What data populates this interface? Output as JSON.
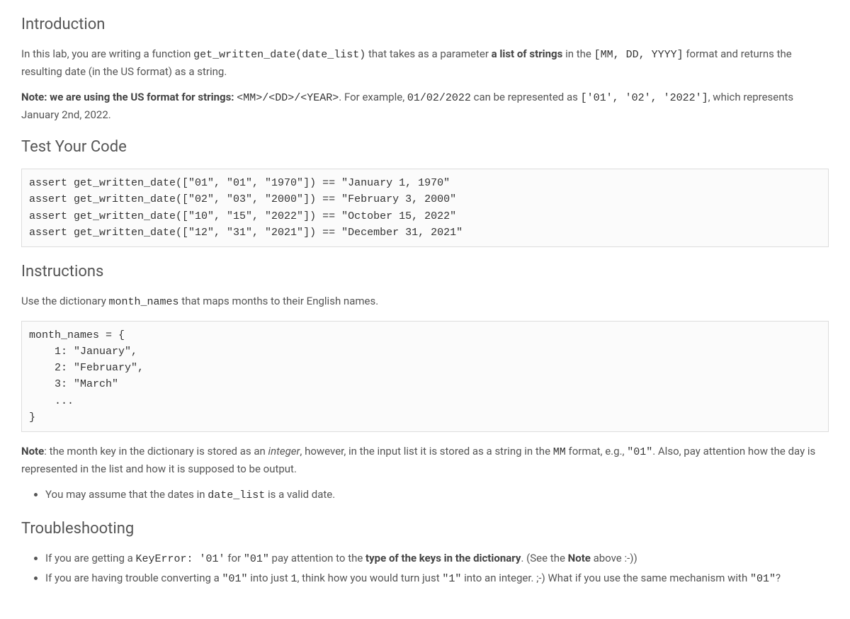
{
  "intro": {
    "heading": "Introduction",
    "p1_a": "In this lab, you are writing a function ",
    "p1_code1": "get_written_date(date_list)",
    "p1_b": " that takes as a parameter ",
    "p1_bold": "a list of strings",
    "p1_c": " in the ",
    "p1_code2": "[MM, DD, YYYY]",
    "p1_d": " format and returns the resulting date (in the US format) as a string.",
    "p2_bold": "Note: we are using the US format for strings: ",
    "p2_code1": "<MM>/<DD>/<YEAR>",
    "p2_a": ". For example, ",
    "p2_code2": "01/02/2022",
    "p2_b": " can be represented as ",
    "p2_code3": "['01', '02', '2022']",
    "p2_c": ", which represents January 2nd, 2022."
  },
  "test": {
    "heading": "Test Your Code",
    "code": "assert get_written_date([\"01\", \"01\", \"1970\"]) == \"January 1, 1970\"\nassert get_written_date([\"02\", \"03\", \"2000\"]) == \"February 3, 2000\"\nassert get_written_date([\"10\", \"15\", \"2022\"]) == \"October 15, 2022\"\nassert get_written_date([\"12\", \"31\", \"2021\"]) == \"December 31, 2021\""
  },
  "instr": {
    "heading": "Instructions",
    "p1_a": "Use the dictionary ",
    "p1_code": "month_names",
    "p1_b": " that maps months to their English names.",
    "code": "month_names = {\n    1: \"January\",\n    2: \"February\",\n    3: \"March\"\n    ...\n}",
    "note_bold": "Note",
    "note_a": ": the month key in the dictionary is stored as an ",
    "note_em": "integer",
    "note_b": ", however, in the input list it is stored as a string in the ",
    "note_code1": "MM",
    "note_c": " format, e.g., ",
    "note_code2": "\"01\"",
    "note_d": ". Also, pay attention how the day is represented in the list and how it is supposed to be output.",
    "bullet_a": "You may assume that the dates in ",
    "bullet_code": "date_list",
    "bullet_b": " is a valid date."
  },
  "trouble": {
    "heading": "Troubleshooting",
    "b1_a": "If you are getting a ",
    "b1_err": "KeyError: '01'",
    "b1_b": " for ",
    "b1_code1": "\"01\"",
    "b1_c": " pay attention to the ",
    "b1_bold": "type of the keys in the dictionary",
    "b1_d": ". (See the ",
    "b1_bold2": "Note",
    "b1_e": " above :-))",
    "b2_a": "If you are having trouble converting a ",
    "b2_code1": "\"01\"",
    "b2_b": " into just ",
    "b2_code2": "1",
    "b2_c": ", think how you would turn just ",
    "b2_code3": "\"1\"",
    "b2_d": " into an integer. ;-) What if you use the same mechanism with ",
    "b2_code4": "\"01\"",
    "b2_e": "?"
  }
}
